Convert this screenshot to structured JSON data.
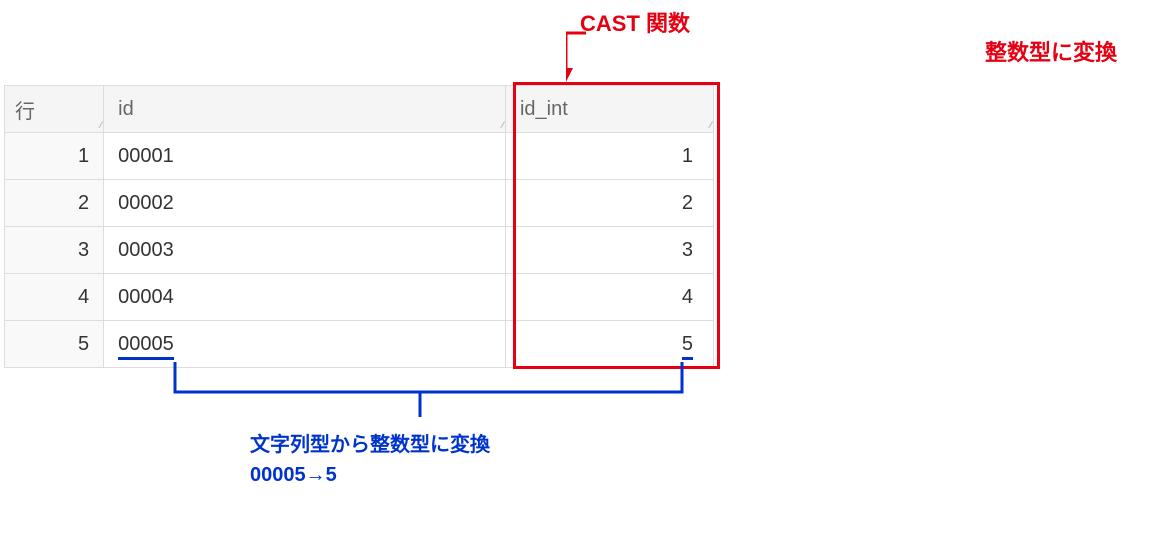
{
  "labels": {
    "topLabel": "CAST 関数",
    "rightLabel": "整数型に変換",
    "bottomLabel1": "文字列型から整数型に変換",
    "bottomLabel2": "00005→5"
  },
  "table": {
    "headers": {
      "row": "行",
      "id": "id",
      "id_int": "id_int"
    },
    "rows": [
      {
        "n": "1",
        "id": "00001",
        "id_int": "1"
      },
      {
        "n": "2",
        "id": "00002",
        "id_int": "2"
      },
      {
        "n": "3",
        "id": "00003",
        "id_int": "3"
      },
      {
        "n": "4",
        "id": "00004",
        "id_int": "4"
      },
      {
        "n": "5",
        "id": "00005",
        "id_int": "5"
      }
    ]
  }
}
